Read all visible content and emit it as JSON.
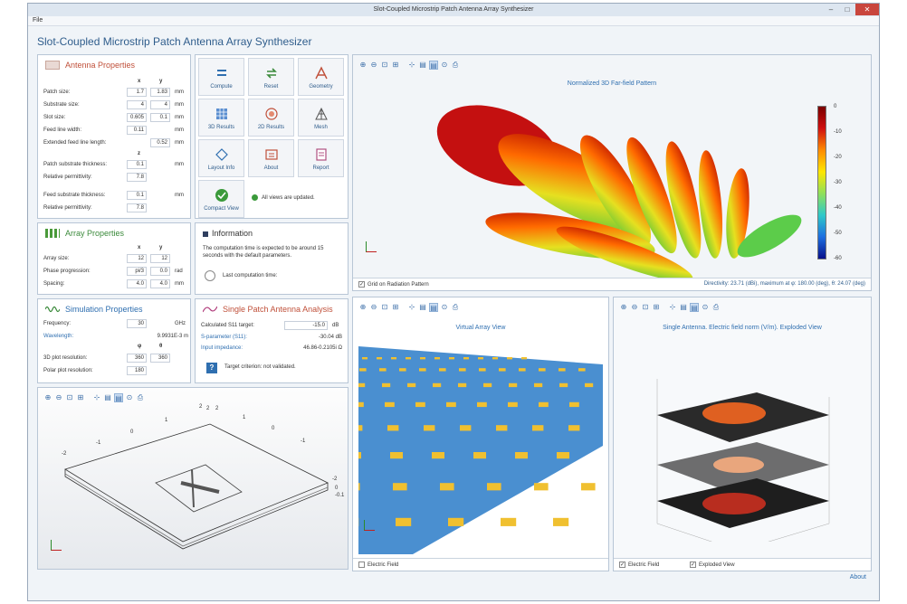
{
  "window": {
    "title": "Slot-Coupled Microstrip Patch Antenna Array Synthesizer",
    "min_glyph": "–",
    "max_glyph": "□",
    "close_glyph": "✕"
  },
  "menu": {
    "file": "File"
  },
  "app": {
    "title": "Slot-Coupled Microstrip Patch Antenna Array Synthesizer",
    "about": "About"
  },
  "antenna": {
    "title": "Antenna Properties",
    "col_x": "x",
    "col_y": "y",
    "col_z": "z",
    "patch_size": {
      "label": "Patch size:",
      "x": "1.7",
      "y": "1.83",
      "unit": "mm"
    },
    "substrate_size": {
      "label": "Substrate size:",
      "x": "4",
      "y": "4",
      "unit": "mm"
    },
    "slot_size": {
      "label": "Slot size:",
      "x": "0.605",
      "y": "0.1",
      "unit": "mm"
    },
    "feed_width": {
      "label": "Feed line width:",
      "x": "0.11",
      "unit": "mm"
    },
    "ext_feed": {
      "label": "Extended feed line length:",
      "y": "0.52",
      "unit": "mm"
    },
    "patch_thick": {
      "label": "Patch substrate thickness:",
      "z": "0.1",
      "unit": "mm"
    },
    "patch_perm": {
      "label": "Relative permittivity:",
      "value": "7.8"
    },
    "feed_thick": {
      "label": "Feed substrate thickness:",
      "z": "0.1",
      "unit": "mm"
    },
    "feed_perm": {
      "label": "Relative permittivity:",
      "value": "7.8"
    }
  },
  "array": {
    "title": "Array Properties",
    "col_x": "x",
    "col_y": "y",
    "size": {
      "label": "Array size:",
      "x": "12",
      "y": "12"
    },
    "phase": {
      "label": "Phase progression:",
      "x": "pi/3",
      "y": "0.0",
      "unit": "rad"
    },
    "spacing": {
      "label": "Spacing:",
      "x": "4.0",
      "y": "4.0",
      "unit": "mm"
    }
  },
  "simulation": {
    "title": "Simulation Properties",
    "frequency": {
      "label": "Frequency:",
      "value": "30",
      "unit": "GHz"
    },
    "wavelength": {
      "label": "Wavelength:",
      "value": "9.9931E-3 m"
    },
    "col_phi": "φ",
    "col_theta": "θ",
    "res3d": {
      "label": "3D plot resolution:",
      "phi": "360",
      "theta": "360"
    },
    "polar": {
      "label": "Polar plot resolution:",
      "value": "180"
    }
  },
  "buttons": {
    "compute": "Compute",
    "reset": "Reset",
    "geometry": "Geometry",
    "results3d": "3D Results",
    "results2d": "2D Results",
    "mesh": "Mesh",
    "layout": "Layout Info",
    "about": "About",
    "report": "Report",
    "compact": "Compact View",
    "status": "All views are updated."
  },
  "info": {
    "title": "Information",
    "text": "The computation time is expected to be around 15 seconds with the default parameters.",
    "last": "Last computation time:"
  },
  "single": {
    "title": "Single Patch Antenna Analysis",
    "s11_target": {
      "label": "Calculated S11 target:",
      "value": "-15.0",
      "unit": "dB"
    },
    "sparam": {
      "label": "S-parameter (S11):",
      "value": "-30.04 dB"
    },
    "impedance": {
      "label": "Input impedance:",
      "value": "46.86-0.2105i Ω"
    },
    "criterion": "Target criterion: not validated."
  },
  "farfield": {
    "title": "Normalized 3D Far-field Pattern",
    "grid_label": "Grid on Radiation Pattern",
    "directivity": "Directivity: 23.71 (dBi), maximum at φ: 180.00 (deg), θ: 24.07 (deg)",
    "colorbar": [
      "0",
      "-10",
      "-20",
      "-30",
      "-40",
      "-50",
      "-60"
    ],
    "colors": {
      "high": "#7a0000",
      "low": "#08108a"
    }
  },
  "array_view": {
    "title": "Virtual Array View",
    "checkbox": "Electric Field",
    "colors": {
      "substrate": "#4a8fd0",
      "patch": "#f0c030"
    }
  },
  "efield_view": {
    "title": "Single Antenna. Electric field norm (V/m). Exploded View",
    "checkbox1": "Electric Field",
    "checkbox2": "Exploded View"
  },
  "geometry_view": {
    "ticks": [
      "2",
      "1",
      "0",
      "-1",
      "-2",
      "-2",
      "-1",
      "0",
      "1",
      "2",
      "2",
      "0",
      "-0.1"
    ]
  },
  "icons": {
    "zoom_in": "⊕",
    "zoom_out": "⊖",
    "zoom_box": "⊡",
    "zoom_extents": "⊞",
    "axis": "⊹",
    "views": "▤",
    "camera": "⊙",
    "print": "⎙",
    "check": "✓",
    "help": "?"
  }
}
